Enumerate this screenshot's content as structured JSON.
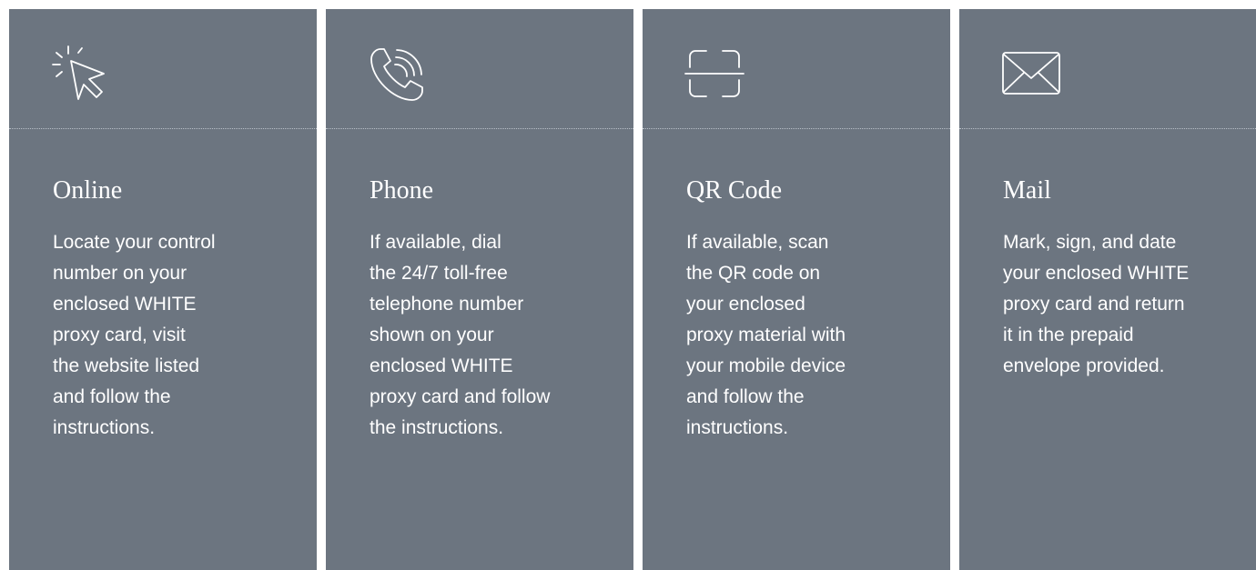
{
  "panels": [
    {
      "icon": "cursor-click-icon",
      "title": "Online",
      "lines": [
        "Locate your control",
        "number on your",
        "enclosed WHITE",
        "proxy card, visit",
        "the website listed",
        "and follow the",
        "instructions."
      ]
    },
    {
      "icon": "phone-ringing-icon",
      "title": "Phone",
      "lines": [
        "If available, dial",
        "the 24/7 toll-free",
        "telephone number",
        "shown on your",
        "enclosed WHITE",
        "proxy card and follow",
        "the instructions."
      ]
    },
    {
      "icon": "qr-scan-icon",
      "title": "QR Code",
      "lines": [
        "If available, scan",
        "the QR code on",
        "your enclosed",
        "proxy material with",
        "your mobile device",
        "and follow the",
        "instructions."
      ]
    },
    {
      "icon": "envelope-icon",
      "title": "Mail",
      "lines": [
        "Mark, sign, and date",
        "your enclosed WHITE",
        "proxy card and return",
        "it in the prepaid",
        "envelope provided."
      ]
    }
  ],
  "colors": {
    "panel_background": "#6c7580",
    "text": "#ffffff",
    "divider": "#b9c0c8"
  }
}
